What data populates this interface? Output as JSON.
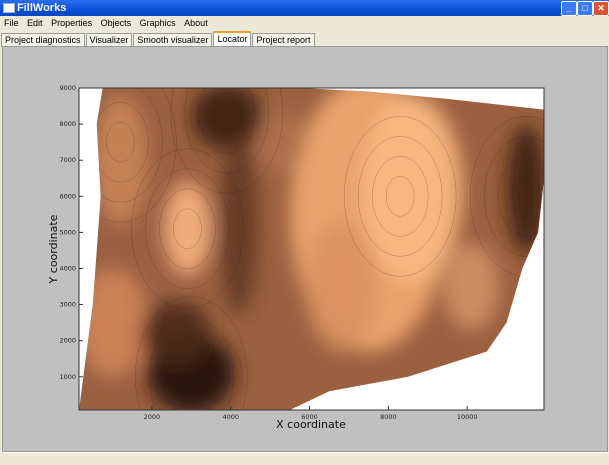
{
  "window": {
    "title": "FillWorks",
    "buttons": [
      "minimize",
      "maximize",
      "close"
    ]
  },
  "menu": [
    "File",
    "Edit",
    "Properties",
    "Objects",
    "Graphics",
    "About"
  ],
  "tabs": [
    "Project diagnostics",
    "Visualizer",
    "Smooth visualizer",
    "Locator",
    "Project report"
  ],
  "active_tab": "Locator",
  "chart_data": {
    "type": "heatmap",
    "subtype": "filled contour",
    "title": "",
    "xlabel": "X coordinate",
    "ylabel": "Y coordinate",
    "xlim": [
      150,
      11950
    ],
    "ylim": [
      80,
      9000
    ],
    "xticks": [
      2000,
      4000,
      6000,
      8000,
      10000
    ],
    "yticks": [
      1000,
      2000,
      3000,
      4000,
      5000,
      6000,
      7000,
      8000,
      9000
    ],
    "colormap": "copper",
    "colors": {
      "dark": "#2a150a",
      "mid": "#9a6040",
      "light": "#f2a870",
      "empty": "#ffffff"
    },
    "grid": false,
    "features": [
      {
        "kind": "minimum",
        "x": 3000,
        "y": 1000
      },
      {
        "kind": "minimum",
        "x": 3900,
        "y": 8300
      },
      {
        "kind": "maximum",
        "x": 2900,
        "y": 5100
      },
      {
        "kind": "maximum",
        "x": 8300,
        "y": 6000
      },
      {
        "kind": "maximum",
        "x": 1200,
        "y": 7500
      },
      {
        "kind": "minimum",
        "x": 11500,
        "y": 6000
      }
    ]
  }
}
